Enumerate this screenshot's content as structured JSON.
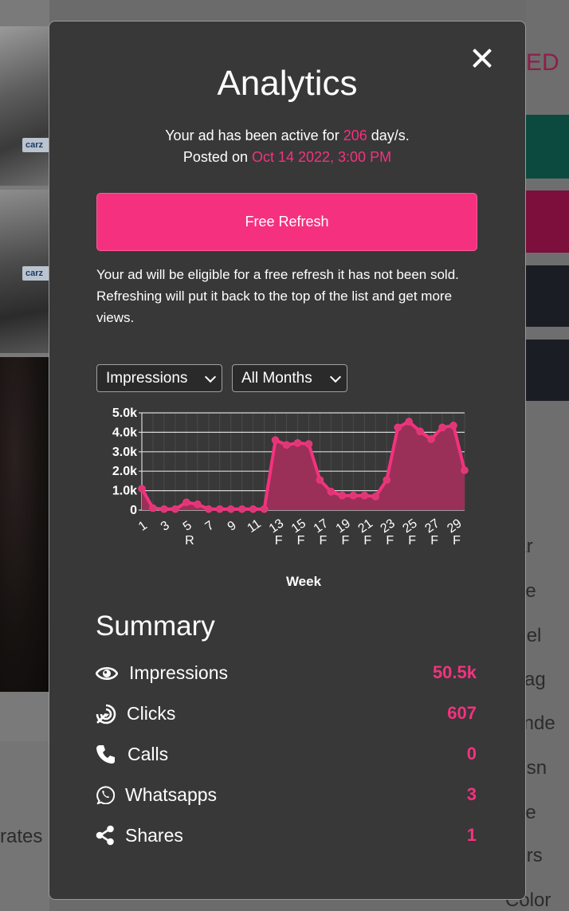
{
  "background": {
    "plate_text": "carz",
    "right_heading_partial": "ED",
    "left_text_partial": "rates",
    "spec_labels_partial": [
      "ear",
      "ake",
      "odel",
      "ileag",
      "ylinde",
      "ansn",
      "ype",
      "oors",
      "Color"
    ]
  },
  "modal": {
    "title": "Analytics",
    "active_prefix": "Your ad has been active for ",
    "active_days": "206",
    "active_suffix": " day/s.",
    "posted_prefix": "Posted on ",
    "posted_date": "Oct 14 2022, 3:00 PM",
    "refresh_button_label": "Free Refresh",
    "refresh_note": "Your ad will be eligible for a free refresh it has not been sold. Refreshing will put it back to the top of the list and get more views.",
    "metric_select_value": "Impressions",
    "period_select_value": "All Months"
  },
  "chart_data": {
    "type": "area",
    "xlabel": "Week",
    "ylabel": "",
    "ylim": [
      0,
      5000
    ],
    "y_ticks": [
      0,
      1000,
      2000,
      3000,
      4000,
      5000
    ],
    "y_tick_labels": [
      "0",
      "1.0k",
      "2.0k",
      "3.0k",
      "4.0k",
      "5.0k"
    ],
    "x": [
      1,
      2,
      3,
      4,
      5,
      6,
      7,
      8,
      9,
      10,
      11,
      12,
      13,
      14,
      15,
      16,
      17,
      18,
      19,
      20,
      21,
      22,
      23,
      24,
      25,
      26,
      27,
      28,
      29,
      30,
      31
    ],
    "x_tick_labels": [
      {
        "label": "1",
        "sub": ""
      },
      {
        "label": "3",
        "sub": ""
      },
      {
        "label": "5",
        "sub": "R"
      },
      {
        "label": "7",
        "sub": ""
      },
      {
        "label": "9",
        "sub": ""
      },
      {
        "label": "11",
        "sub": ""
      },
      {
        "label": "13",
        "sub": "F"
      },
      {
        "label": "15",
        "sub": "F"
      },
      {
        "label": "17",
        "sub": "F"
      },
      {
        "label": "19",
        "sub": "F"
      },
      {
        "label": "21",
        "sub": "F"
      },
      {
        "label": "23",
        "sub": "F"
      },
      {
        "label": "25",
        "sub": "F"
      },
      {
        "label": "27",
        "sub": "F"
      },
      {
        "label": "29",
        "sub": "F"
      }
    ],
    "series": [
      {
        "values": [
          1100,
          100,
          50,
          50,
          400,
          300,
          50,
          50,
          50,
          50,
          50,
          50,
          3600,
          3350,
          3450,
          3400,
          1550,
          950,
          750,
          750,
          750,
          700,
          1550,
          4250,
          4550,
          4050,
          3650,
          4250,
          4350,
          2050
        ],
        "color": "#f5317f"
      }
    ],
    "grid": true
  },
  "summary": {
    "title": "Summary",
    "rows": [
      {
        "label": "Impressions",
        "value": "50.5k",
        "icon": "eye-icon"
      },
      {
        "label": "Clicks",
        "value": "607",
        "icon": "target-click-icon"
      },
      {
        "label": "Calls",
        "value": "0",
        "icon": "phone-icon"
      },
      {
        "label": "Whatsapps",
        "value": "3",
        "icon": "whatsapp-icon"
      },
      {
        "label": "Shares",
        "value": "1",
        "icon": "share-icon"
      }
    ]
  },
  "colors": {
    "accent": "#f5317f",
    "modal_bg": "#383838",
    "area_fill": "#9a3058"
  }
}
